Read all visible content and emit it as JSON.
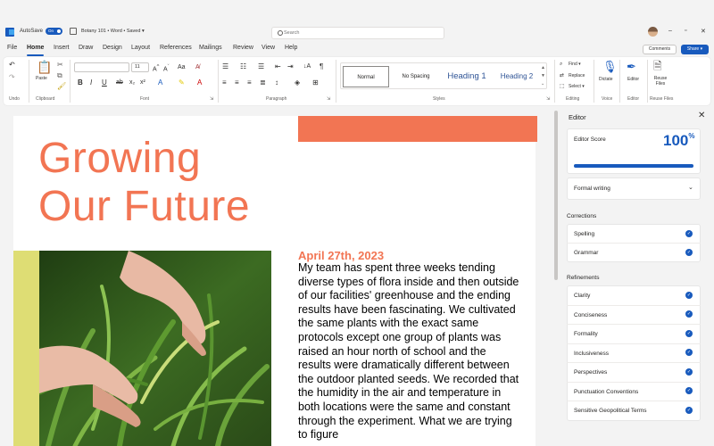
{
  "titlebar": {
    "autosave_label": "AutoSave",
    "autosave_state": "On",
    "doc_title": "Botany 101 • Word • Saved ▾",
    "search_placeholder": "Search",
    "minimize": "–",
    "restore": "▫",
    "close": "✕"
  },
  "menu": {
    "items": [
      "File",
      "Home",
      "Insert",
      "Draw",
      "Design",
      "Layout",
      "References",
      "Mailings",
      "Review",
      "View",
      "Help"
    ],
    "comments_label": "Comments",
    "share_label": "Share ▾"
  },
  "ribbon": {
    "groups": [
      "Undo",
      "Clipboard",
      "Font",
      "Paragraph",
      "Styles",
      "Editing",
      "Voice",
      "Editor",
      "Reuse Files"
    ],
    "paste_label": "Paste",
    "font_name": "",
    "font_size": "11",
    "styles": [
      "Normal",
      "No Spacing",
      "Heading 1",
      "Heading 2"
    ],
    "find_label": "Find ▾",
    "replace_label": "Replace",
    "select_label": "Select ▾",
    "dictate_label": "Dictate",
    "editor_label": "Editor",
    "reuse_label": "Reuse Files"
  },
  "document": {
    "headline_line1": "Growing",
    "headline_line2": "Our Future",
    "date": "April 27th, 2023",
    "body": "My team has spent three weeks tending diverse types of flora inside and then outside of our facilities' greenhouse and the ending results have been fascinating. We cultivated the same plants with the exact same protocols except one group of plants was raised an hour north of school and the results were dramatically different between the outdoor planted seeds. We recorded that the humidity in the air and temperature in both locations were the same and constant through the experiment. What we are trying to figure"
  },
  "editor_pane": {
    "title": "Editor",
    "close": "✕",
    "score_label": "Editor Score",
    "score_value": "100",
    "score_unit": "%",
    "score_fraction": 1.0,
    "style_dropdown": "Formal writing",
    "corrections_heading": "Corrections",
    "corrections": [
      "Spelling",
      "Grammar"
    ],
    "refinements_heading": "Refinements",
    "refinements": [
      "Clarity",
      "Conciseness",
      "Formality",
      "Inclusiveness",
      "Perspectives",
      "Punctuation Conventions",
      "Sensitive Geopolitical Terms"
    ]
  },
  "colors": {
    "accent": "#185abd",
    "orange": "#f27553",
    "yellow": "#dedd74"
  }
}
